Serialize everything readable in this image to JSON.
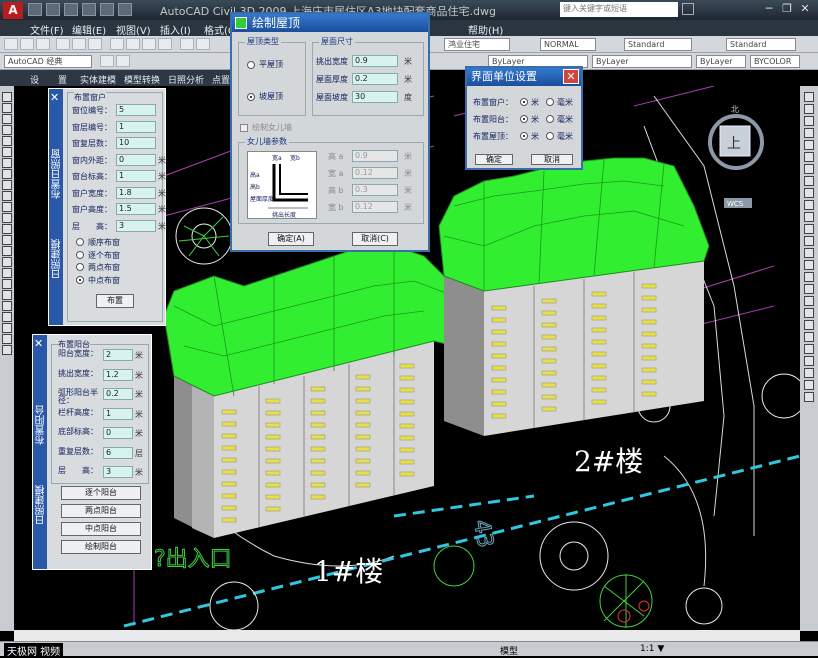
{
  "window": {
    "app_logo": "A",
    "title": "AutoCAD Civil 3D 2009  上海庄市居住区A3地块配套商品住宅.dwg",
    "search_placeholder": "键入关键字或短语"
  },
  "menu": [
    "文件(F)",
    "编辑(E)",
    "视图(V)",
    "插入(I)",
    "格式(O)",
    "帮助(H)"
  ],
  "toolbar": {
    "workspace": "AutoCAD 经典",
    "layer_combo": "鸿业住宅",
    "style_combo": "NORMAL",
    "text_style": "Standard",
    "dim_style": "Standard",
    "color_combo": "ByLayer",
    "linetype_combo": "ByLayer",
    "lineweight_combo": "ByLayer",
    "plot_combo": "BYCOLOR"
  },
  "tangent_menu": [
    "设",
    "置",
    "实体建模",
    "模型转换",
    "日照分析",
    "点置"
  ],
  "window_panel": {
    "side_title": "布置日照窗",
    "side_sub": "日照建模",
    "header": "布置窗户",
    "fields": [
      {
        "label": "窗位编号：",
        "value": "5"
      },
      {
        "label": "窗层编号：",
        "value": "1"
      },
      {
        "label": "窗复层数：",
        "value": "10"
      },
      {
        "label": "窗内外距：",
        "value": "0",
        "unit": "米"
      },
      {
        "label": "窗台标高：",
        "value": "1",
        "unit": "米"
      },
      {
        "label": "窗户宽度：",
        "value": "1.8",
        "unit": "米"
      },
      {
        "label": "窗户高度：",
        "value": "1.5",
        "unit": "米"
      },
      {
        "label": "层　　高：",
        "value": "3",
        "unit": "米"
      }
    ],
    "modes": [
      "顺序布窗",
      "逐个布窗",
      "两点布窗",
      "中点布窗"
    ],
    "mode_selected": "中点布窗",
    "button": "布置"
  },
  "balcony_panel": {
    "side_title": "布置阳台",
    "side_sub": "日照建模",
    "header": "布置阳台",
    "fields": [
      {
        "label": "阳台宽度：",
        "value": "2",
        "unit": "米"
      },
      {
        "label": "挑出宽度：",
        "value": "1.2",
        "unit": "米"
      },
      {
        "label": "弧形阳台半　径：",
        "value": "0.2",
        "unit": "米"
      },
      {
        "label": "栏杆高度：",
        "value": "1",
        "unit": "米"
      },
      {
        "label": "底部标高：",
        "value": "0",
        "unit": "米"
      },
      {
        "label": "重复层数：",
        "value": "6",
        "unit": "层"
      },
      {
        "label": "层　　高：",
        "value": "3",
        "unit": "米"
      }
    ],
    "buttons": [
      "逐个阳台",
      "两点阳台",
      "中点阳台",
      "绘制阳台"
    ]
  },
  "roof_dialog": {
    "title": "绘制屋顶",
    "type_group": "屋顶类型",
    "types": [
      "平屋顶",
      "坡屋顶"
    ],
    "type_selected": "坡屋顶",
    "size_group": "屋面尺寸",
    "size_fields": [
      {
        "label": "挑出宽度",
        "value": "0.9",
        "unit": "米"
      },
      {
        "label": "屋面厚度",
        "value": "0.2",
        "unit": "米"
      },
      {
        "label": "屋面坡度",
        "value": "30",
        "unit": "度"
      }
    ],
    "parapet_check": "绘制女儿墙",
    "parapet_group": "女儿墙参数",
    "parapet_fields": [
      {
        "label": "高 a",
        "value": "0.9",
        "unit": "米"
      },
      {
        "label": "宽 a",
        "value": "0.12",
        "unit": "米"
      },
      {
        "label": "高 b",
        "value": "0.3",
        "unit": "米"
      },
      {
        "label": "宽 b",
        "value": "0.12",
        "unit": "米"
      }
    ],
    "diagram_labels": [
      "宽a",
      "宽b",
      "高a",
      "高b",
      "屋面厚度",
      "挑出长度"
    ],
    "ok": "确定(A)",
    "cancel": "取消(C)"
  },
  "units_dialog": {
    "title": "界面单位设置",
    "rows": [
      {
        "label": "布置窗户：",
        "opt1": "米",
        "opt2": "毫米"
      },
      {
        "label": "布置阳台：",
        "opt1": "米",
        "opt2": "毫米"
      },
      {
        "label": "布置屋顶：",
        "opt1": "米",
        "opt2": "毫米"
      }
    ],
    "ok": "确定",
    "cancel": "取消"
  },
  "viewcube": {
    "face": "上",
    "compass": "WCS",
    "top": "北"
  },
  "drawing": {
    "building1_label": "1#楼",
    "building2_label": "2#楼",
    "entrance_text": "?出入口"
  },
  "status": {
    "model_tab": "模型",
    "scale": "1:1 ▼",
    "watermark": "天极网 视频"
  },
  "colors": {
    "roof": "#2ef02e",
    "wall_light": "#d8d8d8",
    "wall_dark": "#9a9a9a",
    "window": "#e8e04a",
    "panel_stripe": "#2a58a8",
    "dialog_title": "#1b4e9a"
  }
}
